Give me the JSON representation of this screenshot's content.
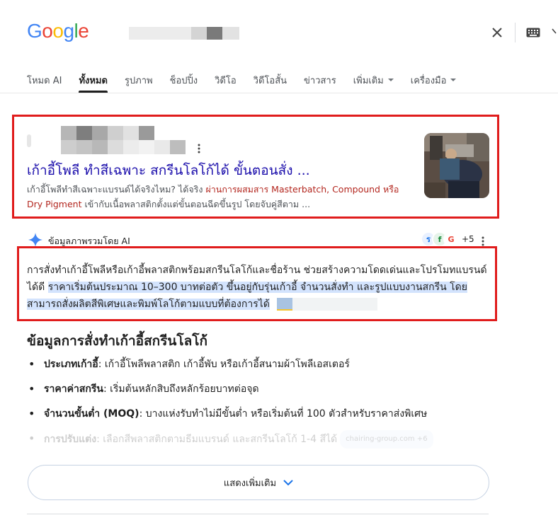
{
  "logo": {
    "text": "Google",
    "letters": [
      {
        "ch": "G",
        "color": "#4285F4"
      },
      {
        "ch": "o",
        "color": "#EA4335"
      },
      {
        "ch": "o",
        "color": "#FBBC05"
      },
      {
        "ch": "g",
        "color": "#4285F4"
      },
      {
        "ch": "l",
        "color": "#34A853"
      },
      {
        "ch": "e",
        "color": "#EA4335"
      }
    ]
  },
  "search": {
    "query_redacted": true,
    "clear_icon": "close-icon",
    "keyboard_icon": "keyboard-icon"
  },
  "tabs": [
    {
      "label": "โหมด AI",
      "active": false
    },
    {
      "label": "ทั้งหมด",
      "active": true
    },
    {
      "label": "รูปภาพ",
      "active": false
    },
    {
      "label": "ช็อปปิ้ง",
      "active": false
    },
    {
      "label": "วิดีโอ",
      "active": false
    },
    {
      "label": "วิดีโอสั้น",
      "active": false
    },
    {
      "label": "ข่าวสาร",
      "active": false
    },
    {
      "label": "เพิ่มเติม",
      "active": false,
      "dropdown": true
    },
    {
      "label": "เครื่องมือ",
      "active": false,
      "dropdown": true
    }
  ],
  "result": {
    "site_redacted": true,
    "title": "เก้าอี้โพลี ทำสีเฉพาะ สกรีนโลโก้ได้ ขั้นตอนสั่ง ...",
    "snippet_part1": "เก้าอี้โพลีทำสีเฉพาะแบรนด์ได้จริงไหม? ได้จริง ",
    "snippet_highlight": "ผ่านการผสมสาร Masterbatch, Compound หรือ Dry Pigment",
    "snippet_part2": " เข้ากับเนื้อพลาสติกตั้งแต่ขั้นตอนฉีดขึ้นรูป โดยจับคู่สีตาม ..."
  },
  "ai_overview": {
    "label": "ข้อมูลภาพรวมโดย AI",
    "sources_more": "+5",
    "text_part1": "การสั่งทำเก้าอี้โพลีหรือเก้าอี้พลาสติกพร้อมสกรีนโลโก้และชื่อร้าน ช่วยสร้างความโดดเด่นและโปรโมทแบรนด์ได้ดี ",
    "text_highlight": "ราคาเริ่มต้นประมาณ 10–300 บาทต่อตัว ขึ้นอยู่กับรุ่นเก้าอี้ จำนวนสั่งทำ และรูปแบบงานสกรีน โดยสามารถสั่งผลิตสีพิเศษและพิมพ์โลโก้ตามแบบที่ต้องการได้",
    "section_title": "ข้อมูลการสั่งทำเก้าอี้สกรีนโลโก้",
    "bullets": [
      {
        "term": "ประเภทเก้าอี้",
        "text": ": เก้าอี้โพลีพลาสติก เก้าอี้พับ หรือเก้าอี้สนามผ้าโพลีเอสเตอร์"
      },
      {
        "term": "ราคาค่าสกรีน",
        "text": ": เริ่มต้นหลักสิบถึงหลักร้อยบาทต่อจุด"
      },
      {
        "term": "จำนวนขั้นต่ำ (MOQ)",
        "text": ": บางแห่งรับทำไม่มีขั้นต่ำ หรือเริ่มต้นที่ 100 ตัวสำหรับราคาส่งพิเศษ"
      },
      {
        "term": "การปรับแต่ง",
        "text": ": เลือกสีพลาสติกตามธีมแบรนด์ และสกรีนโลโก้ 1-4 สีได้",
        "chip": "chairing-group.com +6"
      }
    ],
    "show_more": "แสดงเพิ่มเติม"
  },
  "colors": {
    "link": "#1a0dab",
    "highlight_bg": "#d3e3fd",
    "red_box": "#e01c1c",
    "snippet_highlight": "#b3261e"
  }
}
